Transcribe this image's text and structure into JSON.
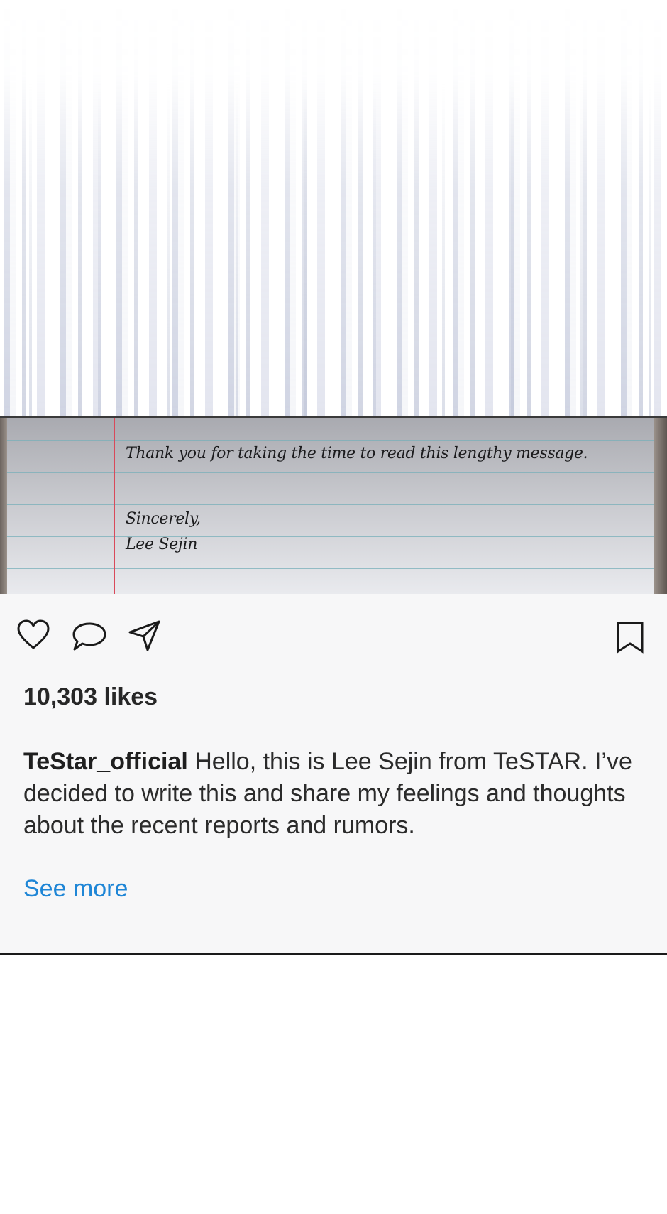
{
  "letter": {
    "line1": "Thank you for taking the time to read this lengthy message.",
    "closing": "Sincerely,",
    "signature": "Lee Sejin"
  },
  "actions": {
    "like_icon": "heart-icon",
    "comment_icon": "comment-icon",
    "share_icon": "send-icon",
    "save_icon": "bookmark-icon"
  },
  "post": {
    "likes": "10,303 likes",
    "username": "TeStar_official",
    "caption": "Hello, this is Lee Sejin from TeSTAR. I’ve decided to write this and share my feelings and thoughts about the recent reports and rumors.",
    "see_more": "See more"
  },
  "colors": {
    "link": "#1f86d6",
    "text": "#2b2b2b",
    "margin_line": "#d9495a",
    "ruled_line": "#78afb9"
  }
}
